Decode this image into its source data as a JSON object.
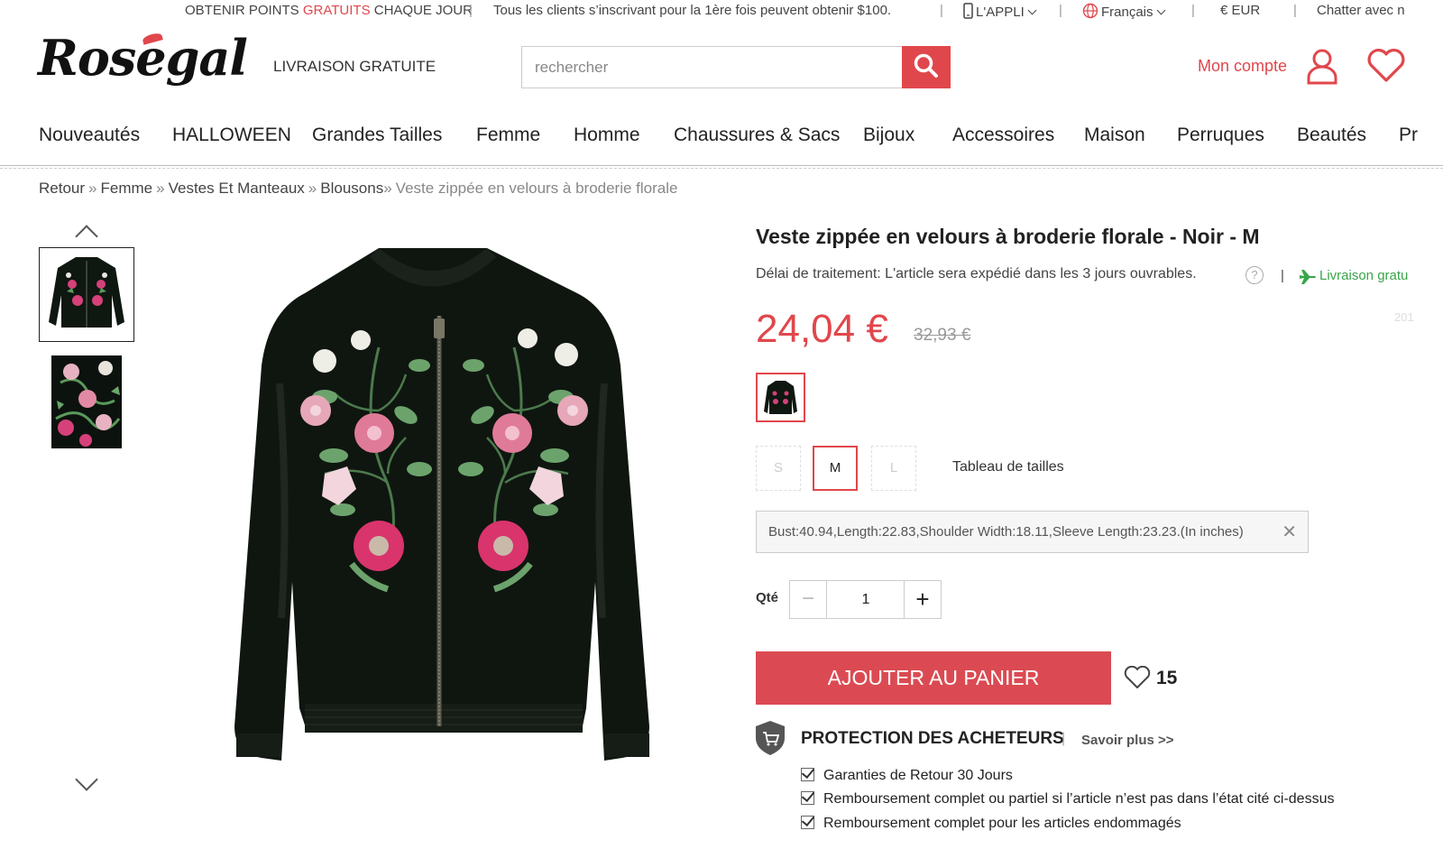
{
  "topbar": {
    "points_pre": "OBTENIR POINTS",
    "points_red": "GRATUITS",
    "points_post": "CHAQUE JOUR",
    "promo": "Tous les clients s’inscrivant pour la 1ère fois peuvent obtenir $100.",
    "app": "L'APPLI",
    "language": "Français",
    "currency": "€ EUR",
    "chat": "Chatter avec n"
  },
  "header": {
    "logo": "Rosegal",
    "free_shipping": "LIVRAISON GRATUITE",
    "search_placeholder": "rechercher",
    "account": "Mon compte"
  },
  "nav": [
    "Nouveautés",
    "HALLOWEEN",
    "Grandes Tailles",
    "Femme",
    "Homme",
    "Chaussures & Sacs",
    "Bijoux",
    "Accessoires",
    "Maison",
    "Perruques",
    "Beautés",
    "Pr"
  ],
  "breadcrumb": {
    "items": [
      "Retour",
      "Femme",
      "Vestes Et Manteaux",
      "Blousons"
    ],
    "current": "Veste zippée en velours à broderie florale"
  },
  "product": {
    "title": "Veste zippée en velours à broderie florale - Noir - M",
    "delay": "Délai de traitement: L'article sera expédié dans les 3 jours ouvrables.",
    "help": "?",
    "shipping": "Livraison gratu",
    "price": "24,04 €",
    "old_price": "32,93 €",
    "faint": "201",
    "sizes": [
      "S",
      "M",
      "L"
    ],
    "selected_size": "M",
    "size_chart": "Tableau de tailles",
    "measurements": "Bust:40.94,Length:22.83,Shoulder Width:18.11,Sleeve Length:23.23.(In inches)",
    "close": "✕",
    "qty_label": "Qté",
    "qty": "1",
    "minus": "−",
    "plus": "+",
    "add_to_cart": "AJOUTER AU PANIER",
    "wish_count": "15"
  },
  "protection": {
    "title": "PROTECTION DES ACHETEURS",
    "sep": "|",
    "more": "Savoir plus >>",
    "items": [
      "Garanties de Retour 30 Jours",
      "Remboursement complet ou partiel si l’article n’est pas dans l’état cité ci-dessus",
      "Remboursement complet pour les articles endommagés"
    ]
  },
  "colors": {
    "accent": "#e0474c",
    "green": "#3aa54a"
  }
}
